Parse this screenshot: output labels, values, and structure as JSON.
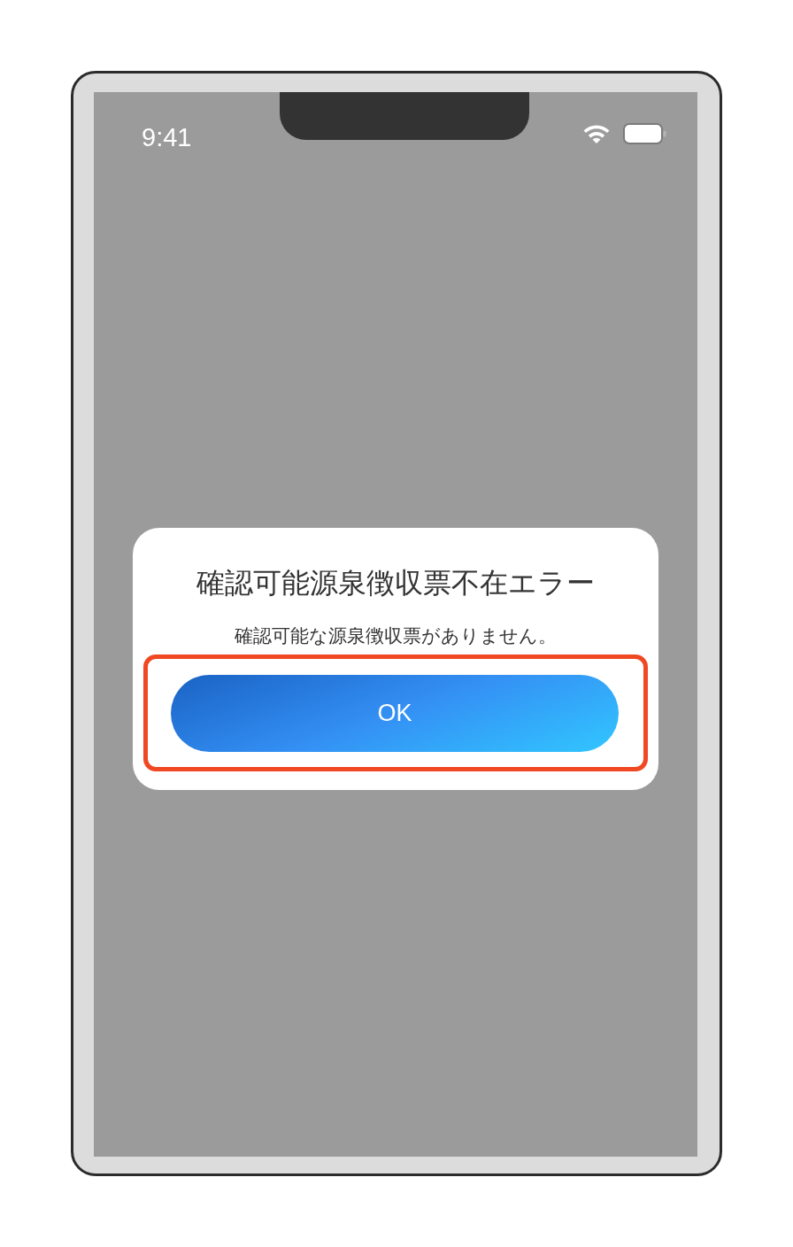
{
  "status_bar": {
    "time": "9:41"
  },
  "dialog": {
    "title": "確認可能源泉徴収票不在エラー",
    "message": "確認可能な源泉徴収票がありません。",
    "button": {
      "label": "OK",
      "highlighted": true
    }
  }
}
